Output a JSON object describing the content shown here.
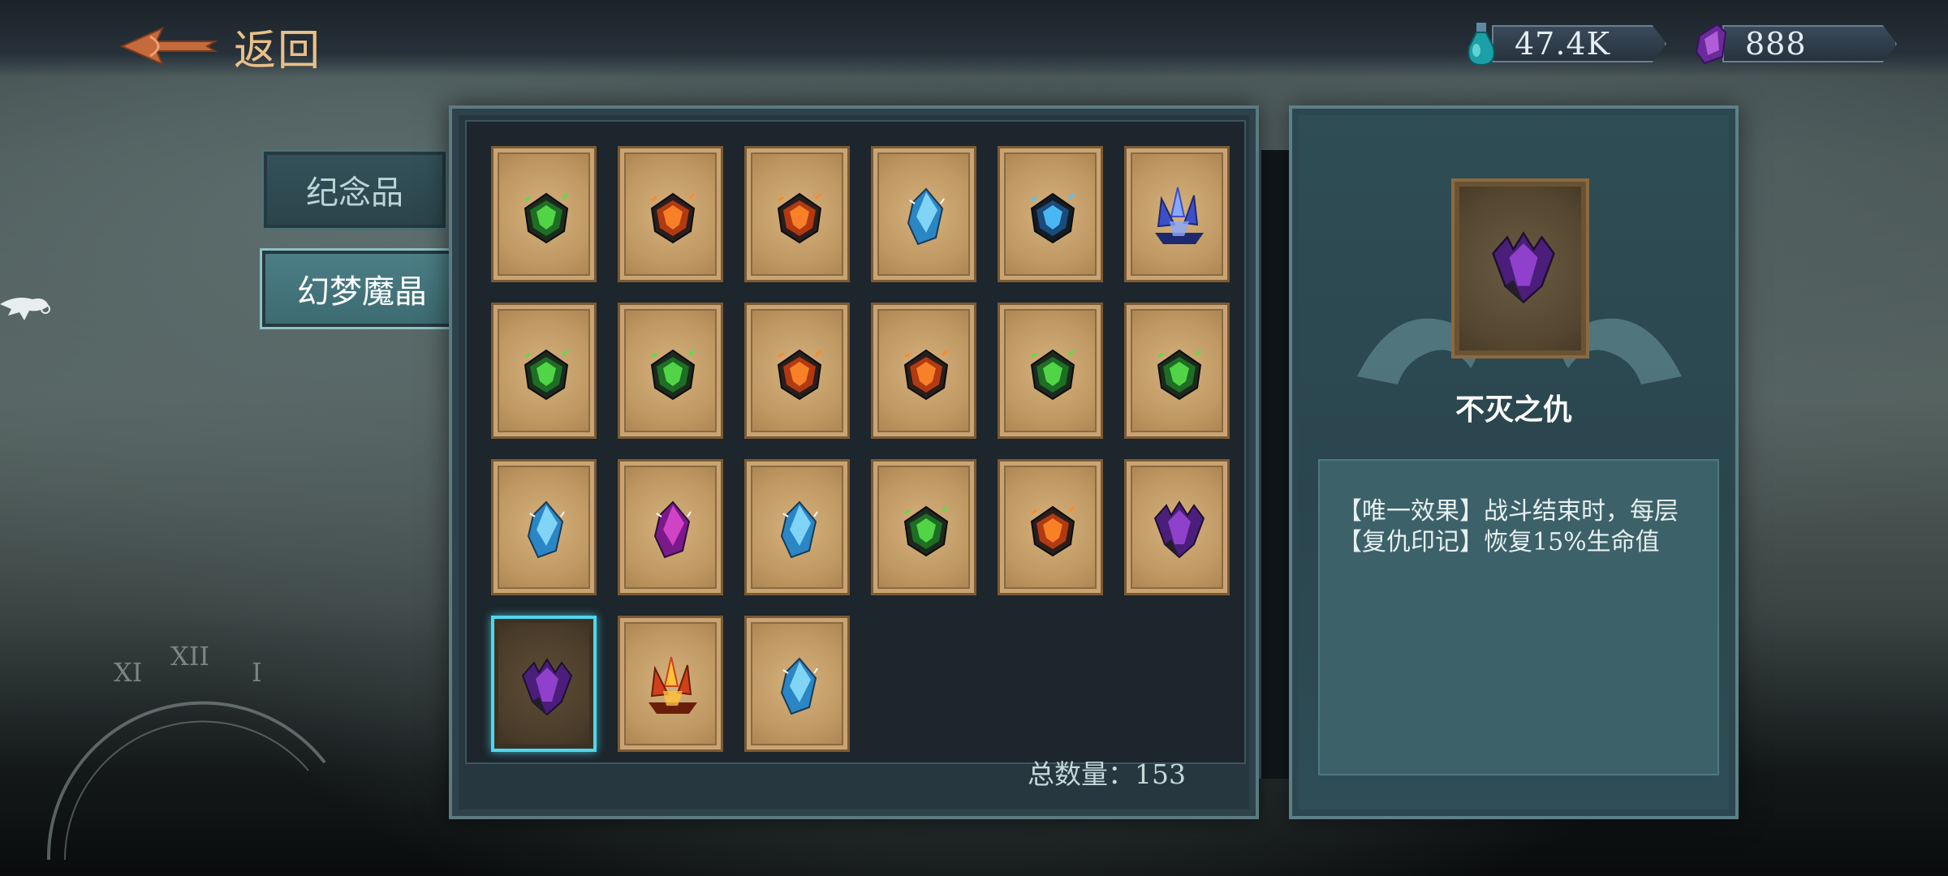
{
  "header": {
    "back_label": "返回",
    "currencies": [
      {
        "icon": "potion-icon",
        "value": "47.4K"
      },
      {
        "icon": "crystal-icon",
        "value": "888"
      }
    ]
  },
  "categories": [
    {
      "label": "纪念品",
      "active": false
    },
    {
      "label": "幻梦魔晶",
      "active": true
    }
  ],
  "items": [
    {
      "gem": "green-crystal"
    },
    {
      "gem": "orange-crystal"
    },
    {
      "gem": "orange-crystal"
    },
    {
      "gem": "blue-shard"
    },
    {
      "gem": "dark-blue-crystal"
    },
    {
      "gem": "blue-cluster"
    },
    {
      "gem": "green-crystal"
    },
    {
      "gem": "green-crystal"
    },
    {
      "gem": "orange-crystal"
    },
    {
      "gem": "orange-crystal"
    },
    {
      "gem": "green-crystal"
    },
    {
      "gem": "green-crystal"
    },
    {
      "gem": "blue-shard"
    },
    {
      "gem": "purple-shard"
    },
    {
      "gem": "blue-shard"
    },
    {
      "gem": "green-crystal"
    },
    {
      "gem": "orange-crystal"
    },
    {
      "gem": "purple-crystal"
    },
    {
      "gem": "purple-crystal",
      "selected": true
    },
    {
      "gem": "amber-cluster"
    },
    {
      "gem": "blue-shard"
    }
  ],
  "footer": {
    "total_label": "总数量：153"
  },
  "detail": {
    "name": "不灭之仇",
    "description_lines": [
      "【唯一效果】战斗结束时，每层",
      "【复仇印记】恢复15%生命值"
    ]
  },
  "gem_colors": {
    "green-crystal": [
      "#1f6e25",
      "#56e04a",
      "#1b2a1c"
    ],
    "orange-crystal": [
      "#b23a12",
      "#ff8a2a",
      "#2a1e1c"
    ],
    "blue-shard": [
      "#2a86c4",
      "#8fe2ff",
      "#1a3a55"
    ],
    "dark-blue-crystal": [
      "#1b4b7a",
      "#4fc4ff",
      "#121c24"
    ],
    "blue-cluster": [
      "#3d4fc8",
      "#88a8ff",
      "#1e2a70"
    ],
    "purple-shard": [
      "#7a1a8a",
      "#e04ad0",
      "#2a0f36"
    ],
    "purple-crystal": [
      "#4a1e7a",
      "#a14ae0",
      "#1e1030"
    ],
    "amber-cluster": [
      "#d0401a",
      "#ffc23a",
      "#6a1e0a"
    ]
  }
}
